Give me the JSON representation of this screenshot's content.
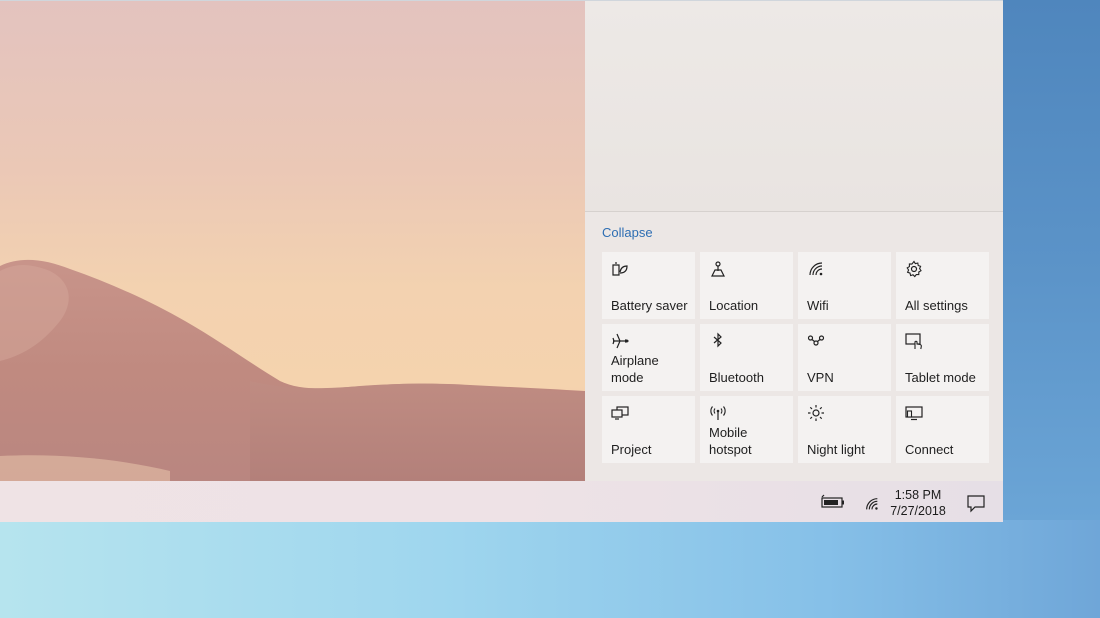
{
  "action_center": {
    "collapse_label": "Collapse",
    "tiles": [
      {
        "label": "Battery saver",
        "icon": "battery-saver-icon"
      },
      {
        "label": "Location",
        "icon": "location-icon"
      },
      {
        "label": "Wifi",
        "icon": "wifi-icon"
      },
      {
        "label": "All settings",
        "icon": "gear-icon"
      },
      {
        "label": "Airplane mode",
        "icon": "airplane-icon"
      },
      {
        "label": "Bluetooth",
        "icon": "bluetooth-icon"
      },
      {
        "label": "VPN",
        "icon": "vpn-icon"
      },
      {
        "label": "Tablet mode",
        "icon": "tablet-mode-icon"
      },
      {
        "label": "Project",
        "icon": "project-icon"
      },
      {
        "label": "Mobile\nhotspot",
        "icon": "hotspot-icon"
      },
      {
        "label": "Night light",
        "icon": "night-light-icon"
      },
      {
        "label": "Connect",
        "icon": "connect-icon"
      }
    ]
  },
  "taskbar": {
    "time": "1:58 PM",
    "date": "7/27/2018",
    "tray_icons": [
      "battery-icon",
      "wifi-icon",
      "action-center-icon"
    ]
  },
  "colors": {
    "accent_link": "#2e6eb3",
    "tile_bg": "#f4f2f1",
    "panel_bg": "#ece7e5"
  }
}
